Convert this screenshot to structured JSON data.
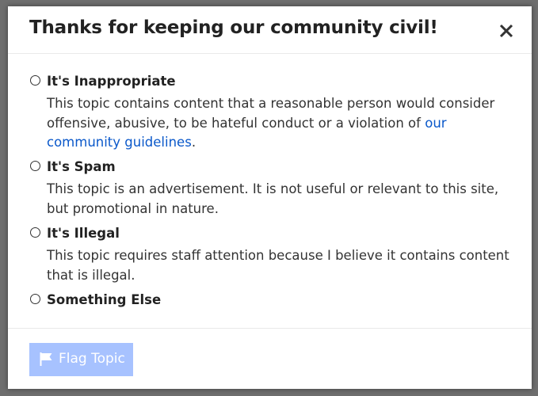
{
  "modal": {
    "title": "Thanks for keeping our community civil!",
    "close_icon": "close-icon"
  },
  "options": [
    {
      "title": "It's Inappropriate",
      "description_before_link": "This topic contains content that a reasonable person would consider offensive, abusive, to be hateful conduct or a violation of ",
      "link_text": "our community guidelines",
      "description_after_link": "."
    },
    {
      "title": "It's Spam",
      "description": "This topic is an advertisement. It is not useful or relevant to this site, but promotional in nature."
    },
    {
      "title": "It's Illegal",
      "description": "This topic requires staff attention because I believe it contains content that is illegal."
    },
    {
      "title": "Something Else"
    }
  ],
  "footer": {
    "flag_button_label": "Flag Topic",
    "flag_icon": "flag-icon"
  },
  "colors": {
    "link": "#0a58ca",
    "button_disabled": "#a7c2ff",
    "title_text": "#222222"
  }
}
